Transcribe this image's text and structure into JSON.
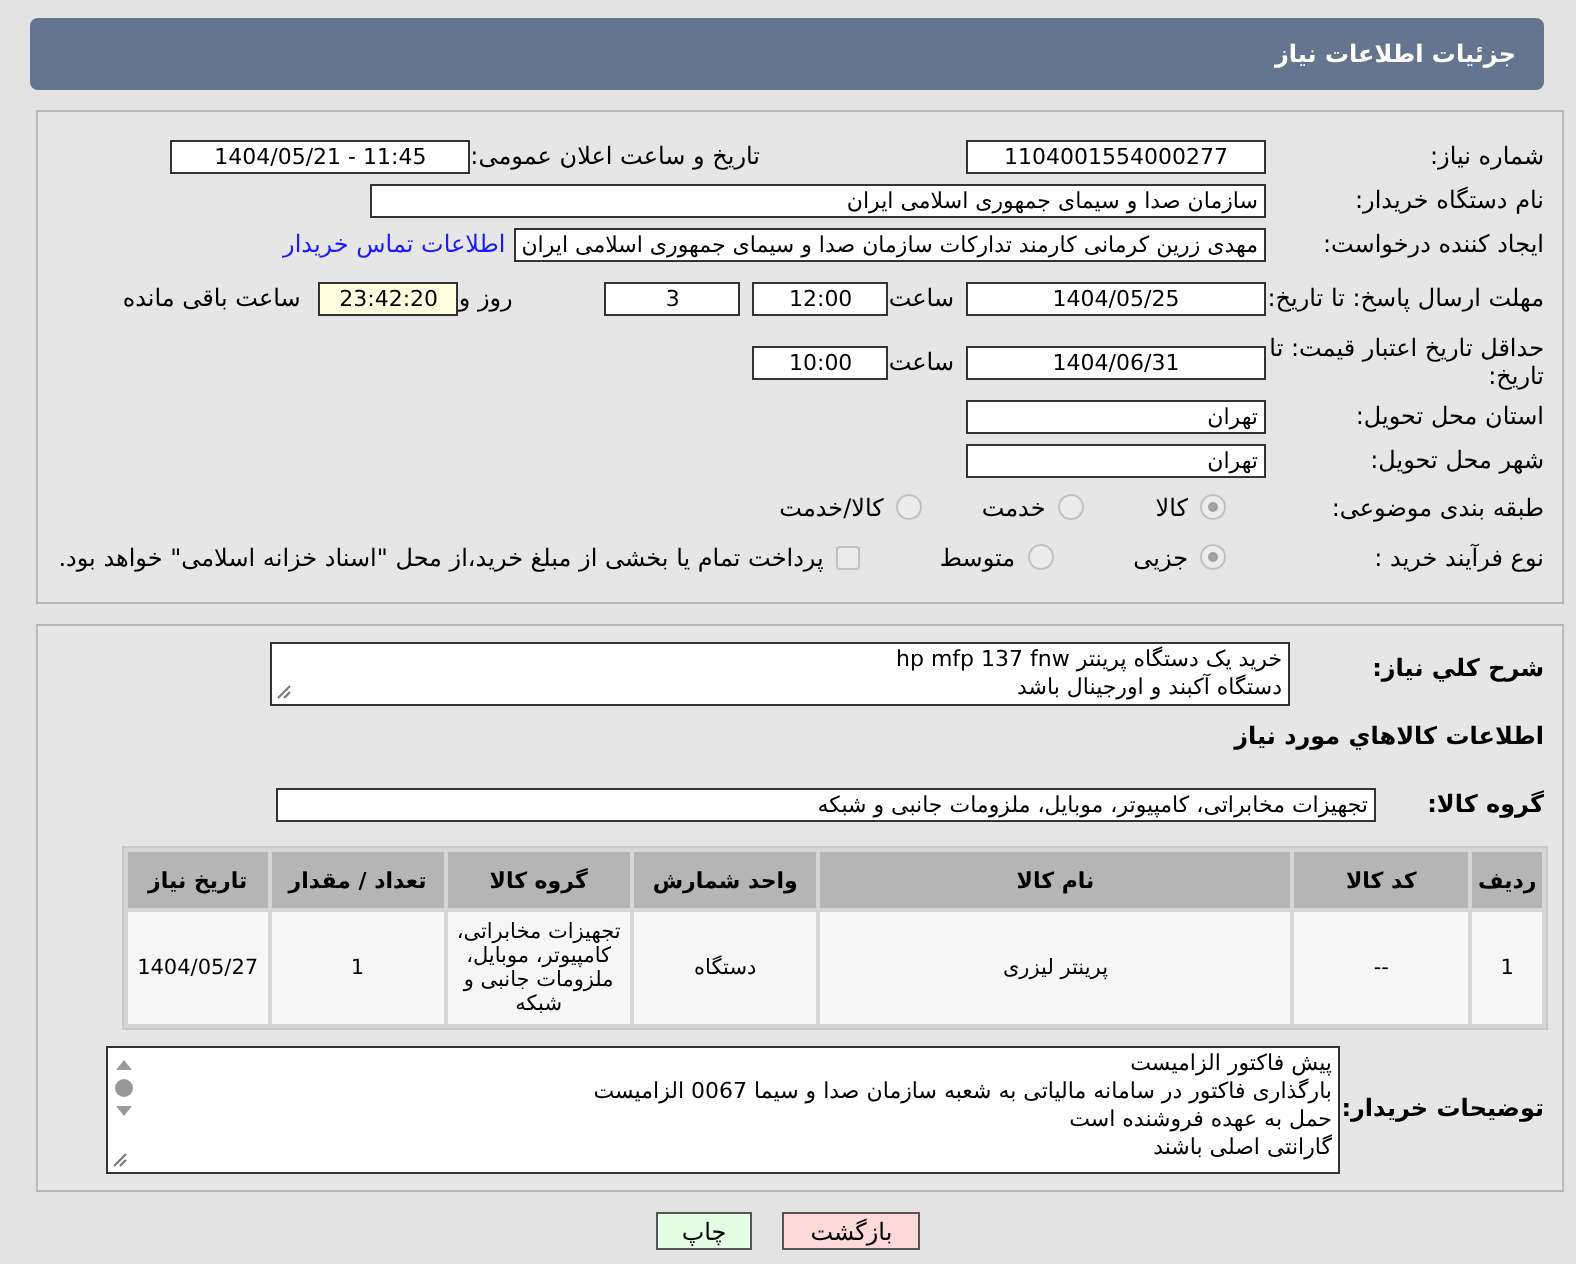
{
  "header": {
    "title": "جزئیات اطلاعات نیاز"
  },
  "need_number": {
    "label": "شماره نیاز:",
    "value": "1104001554000277"
  },
  "announce": {
    "label": "تاریخ و ساعت اعلان عمومی:",
    "value": "1404/05/21 - 11:45"
  },
  "buyer_org": {
    "label": "نام دستگاه خریدار:",
    "value": "سازمان صدا و سیمای جمهوری اسلامی ایران"
  },
  "requester": {
    "label": "ایجاد کننده درخواست:",
    "value": "مهدی زرین کرمانی کارمند تدارکات سازمان صدا و سیمای جمهوری اسلامی ایران",
    "link": "اطلاعات تماس خریدار"
  },
  "reply_deadline": {
    "label": "مهلت ارسال پاسخ: تا تاریخ:",
    "date": "1404/05/25",
    "time_label": "ساعت",
    "time": "12:00",
    "days": "3",
    "days_label": "روز و",
    "remaining": "23:42:20",
    "remaining_label": "ساعت باقی مانده"
  },
  "price_validity": {
    "label": "حداقل تاریخ اعتبار قیمت: تا تاریخ:",
    "date": "1404/06/31",
    "time_label": "ساعت",
    "time": "10:00"
  },
  "province": {
    "label": "استان محل تحویل:",
    "value": "تهران"
  },
  "city": {
    "label": "شهر محل تحویل:",
    "value": "تهران"
  },
  "category": {
    "label": "طبقه بندی موضوعی:",
    "options": [
      {
        "label": "کالا",
        "selected": true
      },
      {
        "label": "خدمت",
        "selected": false
      },
      {
        "label": "کالا/خدمت",
        "selected": false
      }
    ]
  },
  "process": {
    "label": "نوع فرآیند خرید :",
    "options": [
      {
        "label": "جزیی",
        "selected": true
      },
      {
        "label": "متوسط",
        "selected": false
      }
    ],
    "treasury": {
      "label": "پرداخت تمام یا بخشی از مبلغ خرید،از محل \"اسناد خزانه اسلامی\" خواهد بود.",
      "checked": false
    }
  },
  "description": {
    "label": "شرح کلي نياز:",
    "lines": [
      "خرید یک دستگاه پرینتر hp mfp 137 fnw",
      "دستگاه آکبند و اورجینال باشد"
    ]
  },
  "goods_heading": "اطلاعات کالاهاي مورد نياز",
  "goods_group": {
    "label": "گروه کالا:",
    "value": "تجهیزات مخابراتی، کامپیوتر، موبایل، ملزومات جانبی و شبکه"
  },
  "table": {
    "columns": [
      "ردیف",
      "کد کالا",
      "نام کالا",
      "واحد شمارش",
      "گروه کالا",
      "تعداد / مقدار",
      "تاریخ نیاز"
    ],
    "rows": [
      [
        "1",
        "--",
        "پرینتر لیزری",
        "دستگاه",
        "تجهیزات مخابراتی، کامپیوتر، موبایل، ملزومات جانبی و شبکه",
        "1",
        "1404/05/27"
      ]
    ]
  },
  "buyer_notes": {
    "label": "توضیحات خریدار:",
    "lines": [
      "پیش فاکتور الزامیست",
      "بارگذاری فاکتور در سامانه مالیاتی به شعبه سازمان صدا و سیما 0067 الزامیست",
      "حمل به عهده فروشنده است",
      "گارانتی اصلی باشند"
    ]
  },
  "buttons": [
    {
      "label": "بازگشت",
      "kind": "back"
    },
    {
      "label": "چاپ",
      "kind": "print"
    }
  ]
}
